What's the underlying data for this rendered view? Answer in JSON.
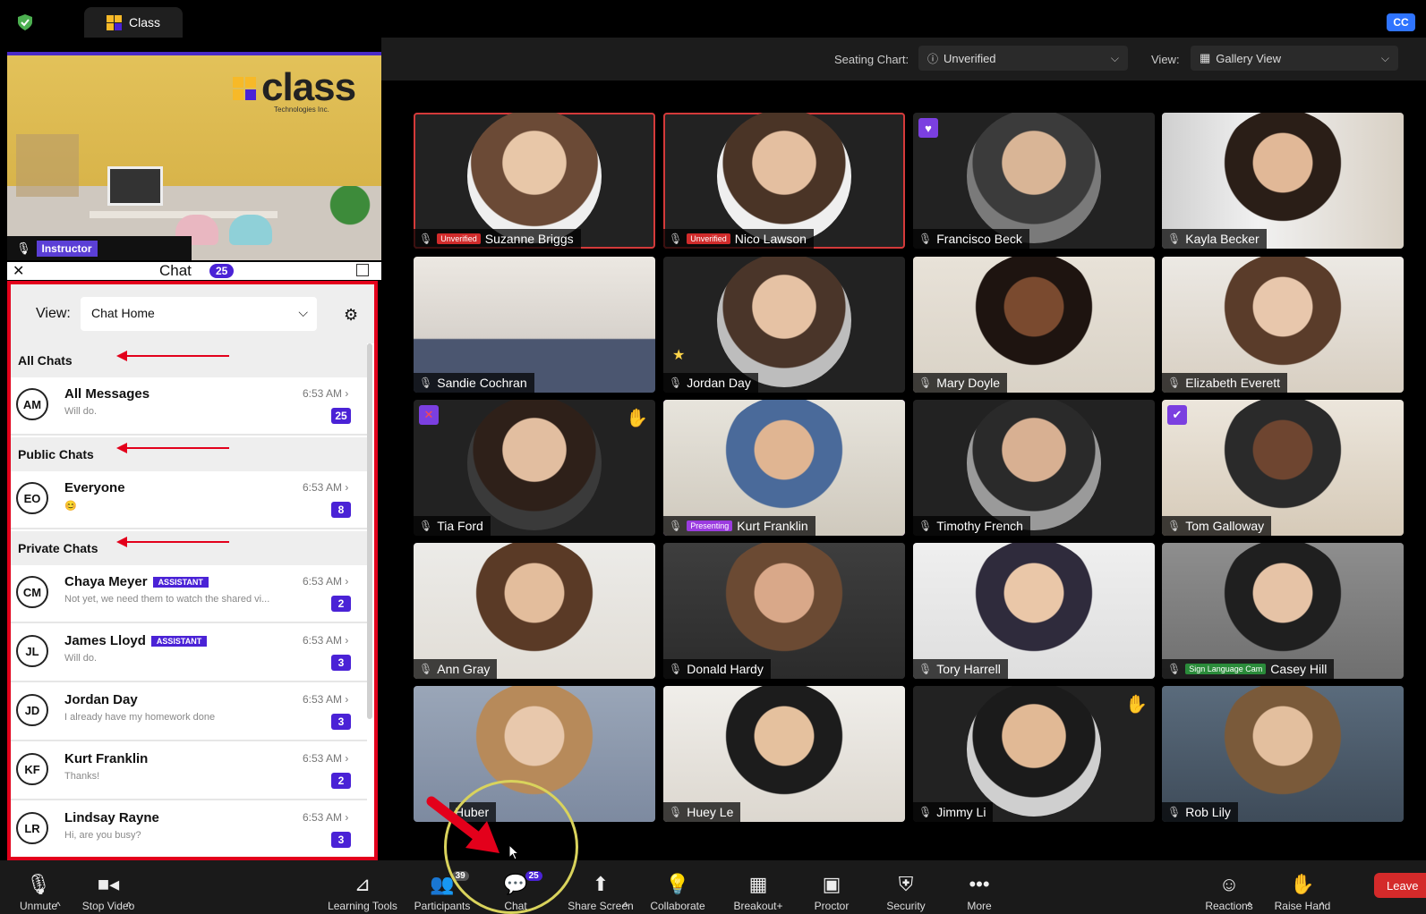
{
  "topbar": {
    "tab_title": "Class",
    "cc_label": "CC"
  },
  "seating": {
    "label": "Seating Chart:",
    "value": "Unverified",
    "view_label": "View:",
    "view_value": "Gallery View"
  },
  "instructor": {
    "brand_word": "class",
    "brand_sub": "Technologies Inc.",
    "badge": "Instructor"
  },
  "chat": {
    "title": "Chat",
    "count": "25",
    "view_label": "View:",
    "view_value": "Chat Home",
    "sections": {
      "all": "All Chats",
      "public": "Public Chats",
      "private": "Private Chats"
    },
    "items": [
      {
        "initials": "AM",
        "name": "All Messages",
        "preview": "Will do.",
        "time": "6:53 AM",
        "badge": "25",
        "tag": ""
      },
      {
        "initials": "EO",
        "name": "Everyone",
        "preview": "😊",
        "time": "6:53 AM",
        "badge": "8",
        "tag": ""
      },
      {
        "initials": "CM",
        "name": "Chaya Meyer",
        "preview": "Not yet, we need them to watch the shared vi...",
        "time": "6:53 AM",
        "badge": "2",
        "tag": "ASSISTANT"
      },
      {
        "initials": "JL",
        "name": "James Lloyd",
        "preview": "Will do.",
        "time": "6:53 AM",
        "badge": "3",
        "tag": "ASSISTANT"
      },
      {
        "initials": "JD",
        "name": "Jordan Day",
        "preview": "I already have my homework done",
        "time": "6:53 AM",
        "badge": "3",
        "tag": ""
      },
      {
        "initials": "KF",
        "name": "Kurt Franklin",
        "preview": "Thanks!",
        "time": "6:53 AM",
        "badge": "2",
        "tag": ""
      },
      {
        "initials": "LR",
        "name": "Lindsay Rayne",
        "preview": "Hi, are you busy?",
        "time": "6:53 AM",
        "badge": "3",
        "tag": ""
      }
    ]
  },
  "participants": [
    {
      "name": "Suzanne Briggs",
      "tag": "Unverified"
    },
    {
      "name": "Nico Lawson",
      "tag": "Unverified"
    },
    {
      "name": "Francisco Beck",
      "tag": ""
    },
    {
      "name": "Kayla Becker",
      "tag": ""
    },
    {
      "name": "Sandie Cochran",
      "tag": ""
    },
    {
      "name": "Jordan Day",
      "tag": ""
    },
    {
      "name": "Mary Doyle",
      "tag": ""
    },
    {
      "name": "Elizabeth Everett",
      "tag": ""
    },
    {
      "name": "Tia Ford",
      "tag": ""
    },
    {
      "name": "Kurt Franklin",
      "tag": "Presenting"
    },
    {
      "name": "Timothy French",
      "tag": ""
    },
    {
      "name": "Tom Galloway",
      "tag": ""
    },
    {
      "name": "Ann Gray",
      "tag": ""
    },
    {
      "name": "Donald Hardy",
      "tag": ""
    },
    {
      "name": "Tory Harrell",
      "tag": ""
    },
    {
      "name": "Casey Hill",
      "tag": "Sign Language Cam"
    },
    {
      "name": "Huber",
      "tag": ""
    },
    {
      "name": "Huey Le",
      "tag": ""
    },
    {
      "name": "Jimmy Li",
      "tag": ""
    },
    {
      "name": "Rob Lily",
      "tag": ""
    }
  ],
  "toolbar": {
    "unmute": "Unmute",
    "stop_video": "Stop Video",
    "learning_tools": "Learning Tools",
    "participants": "Participants",
    "participants_count": "39",
    "chat": "Chat",
    "chat_count": "25",
    "share_screen": "Share Screen",
    "collaborate": "Collaborate",
    "breakout": "Breakout+",
    "proctor": "Proctor",
    "security": "Security",
    "more": "More",
    "reactions": "Reactions",
    "raise_hand": "Raise Hand",
    "leave": "Leave"
  },
  "colors": {
    "accent": "#4a22d6",
    "annotation": "#e3001b",
    "unverified": "#d12b2b",
    "presenting": "#9b3ce0"
  }
}
